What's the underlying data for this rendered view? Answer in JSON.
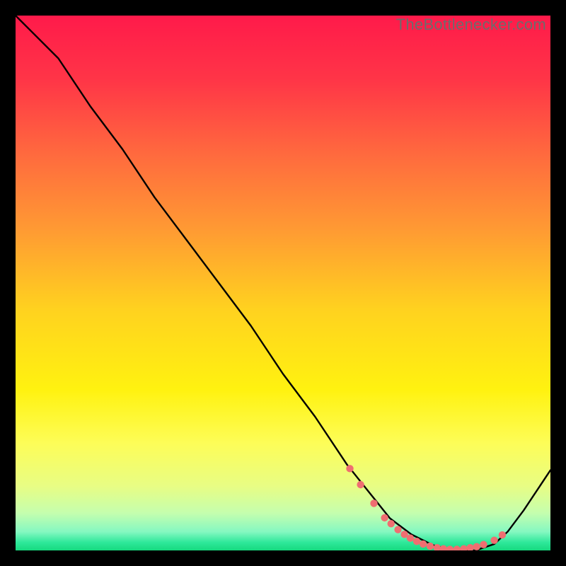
{
  "watermark": "TheBottlenecker.com",
  "chart_data": {
    "type": "line",
    "title": "",
    "xlabel": "",
    "ylabel": "",
    "xlim": [
      0,
      100
    ],
    "ylim": [
      0,
      100
    ],
    "x": [
      0,
      3,
      8,
      14,
      20,
      26,
      32,
      38,
      44,
      50,
      56,
      62,
      66,
      70,
      74,
      78,
      82,
      86,
      89.5,
      92,
      95,
      98,
      100
    ],
    "values": [
      100,
      97,
      92,
      83,
      75,
      66,
      58,
      50,
      42,
      33,
      25,
      16,
      11,
      6,
      3,
      1,
      0,
      0,
      1.2,
      3.5,
      7.5,
      12,
      15
    ],
    "marker_points": {
      "x": [
        62.5,
        64.5,
        67,
        69,
        70.2,
        71.5,
        72.7,
        73.8,
        75,
        76.2,
        77.5,
        78.8,
        80,
        81.2,
        82.5,
        83.8,
        85,
        86.2,
        87.5,
        89.5,
        91
      ],
      "values": [
        15.3,
        12.3,
        8.8,
        6.1,
        5.0,
        3.9,
        3.0,
        2.3,
        1.7,
        1.2,
        0.8,
        0.5,
        0.3,
        0.2,
        0.2,
        0.3,
        0.5,
        0.7,
        1.1,
        1.9,
        2.9
      ]
    },
    "gradient_stops": [
      {
        "offset": 0.0,
        "color": "#ff1a4a"
      },
      {
        "offset": 0.12,
        "color": "#ff3547"
      },
      {
        "offset": 0.26,
        "color": "#ff6a3e"
      },
      {
        "offset": 0.4,
        "color": "#ff9a33"
      },
      {
        "offset": 0.55,
        "color": "#ffd21f"
      },
      {
        "offset": 0.7,
        "color": "#fff210"
      },
      {
        "offset": 0.8,
        "color": "#fdfd58"
      },
      {
        "offset": 0.88,
        "color": "#e8fd84"
      },
      {
        "offset": 0.93,
        "color": "#c5feae"
      },
      {
        "offset": 0.965,
        "color": "#85f8c1"
      },
      {
        "offset": 0.985,
        "color": "#2ee89a"
      },
      {
        "offset": 1.0,
        "color": "#16d97f"
      }
    ],
    "marker_color": "#ef6e71",
    "line_color": "#000000"
  }
}
